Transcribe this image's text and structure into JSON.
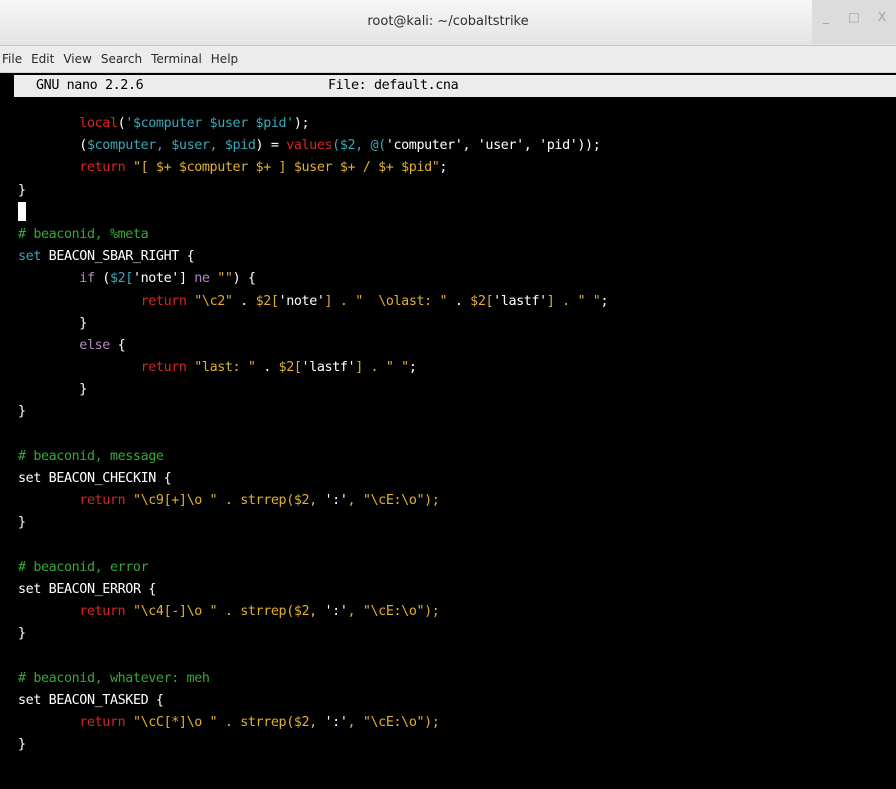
{
  "window": {
    "title": "root@kali: ~/cobaltstrike",
    "controls": {
      "minimize": "_",
      "maximize": "□",
      "close": "X"
    }
  },
  "menubar": {
    "items": [
      "File",
      "Edit",
      "View",
      "Search",
      "Terminal",
      "Help"
    ]
  },
  "nano": {
    "version": "GNU nano 2.2.6",
    "file": "File: default.cna"
  },
  "code": {
    "l1": {
      "indent": "        ",
      "kw": "local",
      "a": "(",
      "b": "'$computer $user $pid'",
      "c": ");"
    },
    "l2": {
      "indent": "        ",
      "a": "(",
      "b": "$computer, $user, $pid",
      "c": ") = ",
      "d": "values",
      "e": "($2, @(",
      "f": "'computer'",
      "g": ", ",
      "h": "'user'",
      "i": ", ",
      "j": "'pid'",
      "k": "));"
    },
    "l3": {
      "indent": "        ",
      "kw": "return",
      "s": " \"[ $+ $computer $+ ] $user $+ / $+ $pid\"",
      "end": ";"
    },
    "l4": "}",
    "l6": "# beaconid, %meta",
    "l7": {
      "set": "set",
      "name": " BEACON_SBAR_RIGHT {"
    },
    "l8": {
      "indent": "        ",
      "kw": "if",
      "a": " (",
      "b": "$2[",
      "c": "'note'",
      "d": "] ",
      "e": "ne",
      "f": " \"\"",
      "g": ") {"
    },
    "l9": {
      "indent": "                ",
      "kw": "return",
      "s1": " \"\\c2\"",
      "p1": " . ",
      "v1": "$2[",
      "q1": "'note'",
      "p2": "] . ",
      "s2": "\"  \\olast: \"",
      "p3": " . ",
      "v2": "$2[",
      "q2": "'lastf'",
      "p4": "] . ",
      "s3": "\" \"",
      "end": ";"
    },
    "l10": "        }",
    "l11": {
      "indent": "        ",
      "kw": "else",
      "rest": " {"
    },
    "l12": {
      "indent": "                ",
      "kw": "return",
      "s1": " \"last: \"",
      "p1": " . ",
      "v1": "$2[",
      "q1": "'lastf'",
      "p2": "] . ",
      "s2": "\" \"",
      "end": ";"
    },
    "l13": "        }",
    "l14": "}",
    "l16": "# beaconid, message",
    "l17": {
      "set": "set",
      "name": " BEACON_CHECKIN {"
    },
    "l18": {
      "indent": "        ",
      "kw": "return",
      "s1": " \"\\c9[+]\\o \"",
      "p1": " . strrep($2, ",
      "q1": "':'",
      "p2": ", ",
      "s2": "\"\\cE:\\o\"",
      "end": ");"
    },
    "l19": "}",
    "l21": "# beaconid, error",
    "l22": {
      "set": "set",
      "name": " BEACON_ERROR {"
    },
    "l23": {
      "indent": "        ",
      "kw": "return",
      "s1": " \"\\c4[-]\\o \"",
      "p1": " . strrep($2, ",
      "q1": "':'",
      "p2": ", ",
      "s2": "\"\\cE:\\o\"",
      "end": ");"
    },
    "l24": "}",
    "l26": "# beaconid, whatever: meh",
    "l27": {
      "set": "set",
      "name": " BEACON_TASKED {"
    },
    "l28": {
      "indent": "        ",
      "kw": "return",
      "s1": " \"\\cC[*]\\o \"",
      "p1": " . strrep($2, ",
      "q1": "':'",
      "p2": ", ",
      "s2": "\"\\cE:\\o\"",
      "end": ");"
    },
    "l29": "}"
  },
  "colors": {
    "keyword": "#d52525",
    "control": "#b18ac2",
    "variable": "#38a8b8",
    "string": "#e0b02b",
    "comment": "#36a836",
    "background": "#000000",
    "foreground": "#ffffff"
  }
}
